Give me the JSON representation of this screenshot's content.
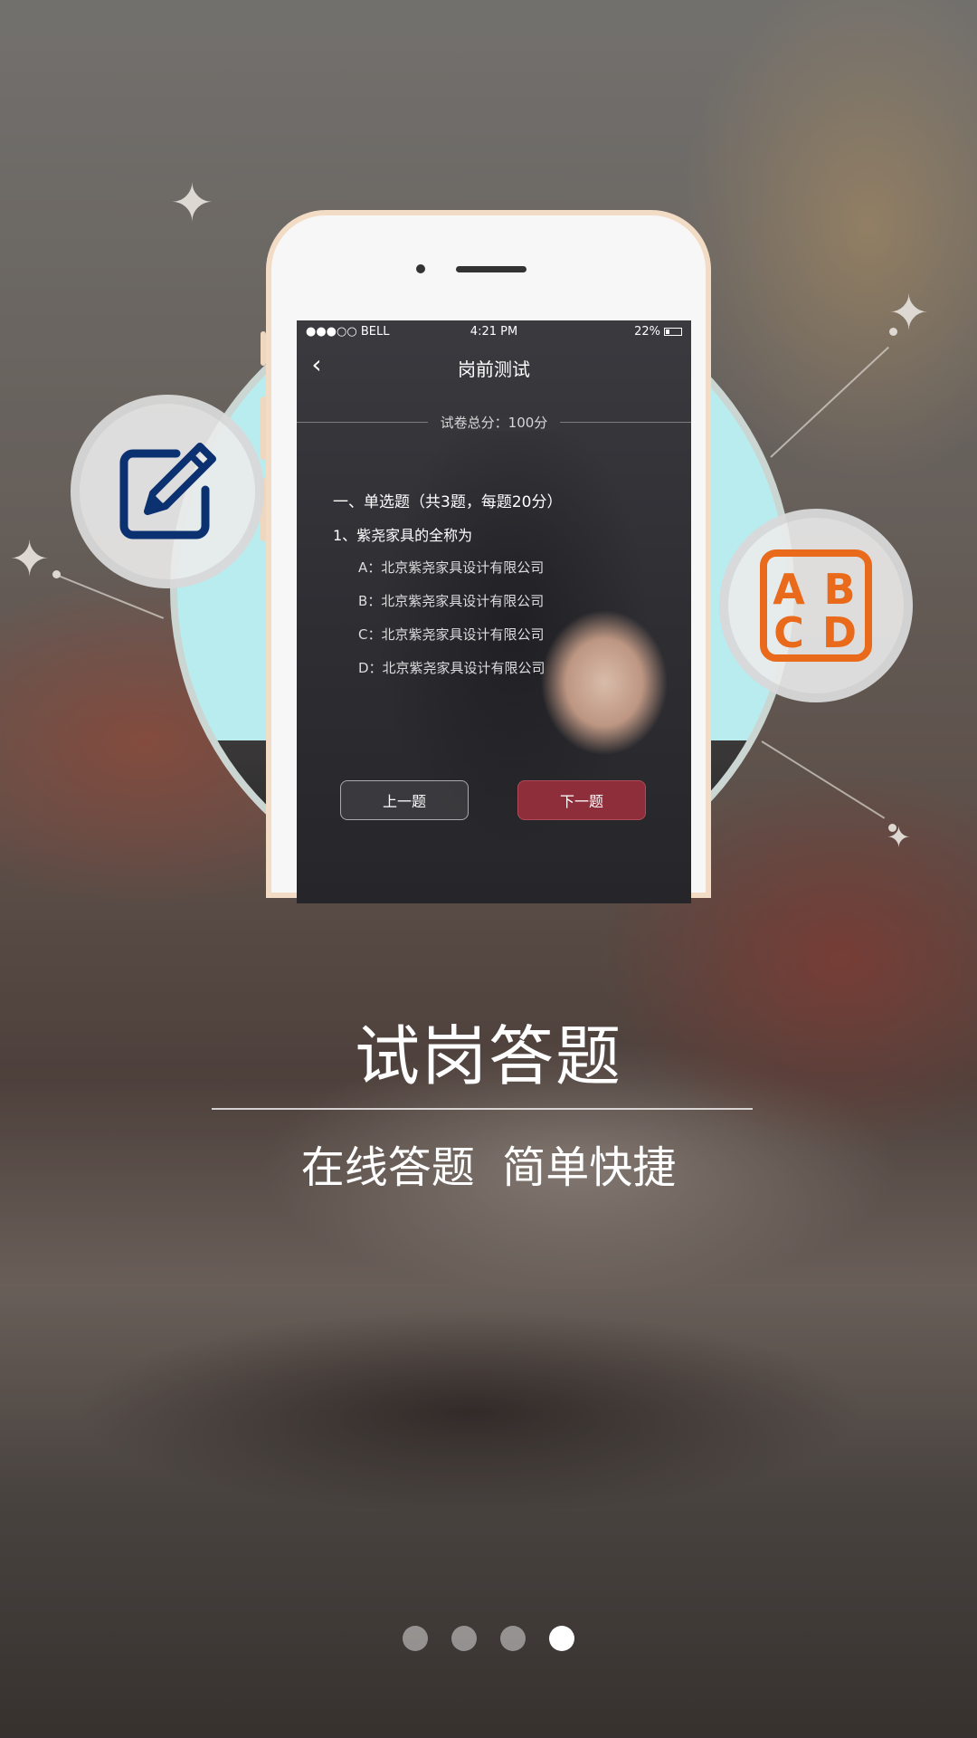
{
  "status_bar": {
    "carrier": "●●●○○ BELL",
    "time": "4:21 PM",
    "battery": "22%"
  },
  "screen": {
    "title": "岗前测试",
    "score": "试卷总分：100分",
    "section": "一、单选题（共3题，每题20分）",
    "question": "1、紫尧家具的全称为",
    "options": [
      "A：北京紫尧家具设计有限公司",
      "B：北京紫尧家具设计有限公司",
      "C：北京紫尧家具设计有限公司",
      "D：北京紫尧家具设计有限公司"
    ],
    "prev_button": "上一题",
    "next_button": "下一题"
  },
  "icons": {
    "edit": "edit-pencil-icon",
    "abcd": "abcd-choice-icon",
    "edit_color": "#0b3170",
    "abcd_color": "#e86a1a"
  },
  "caption": {
    "title": "试岗答题",
    "subtitle": "在线答题  简单快捷"
  },
  "pager": {
    "total": 4,
    "active": 4
  },
  "colors": {
    "accent_red": "#8e2e3a",
    "circle": "#b9ecef"
  }
}
